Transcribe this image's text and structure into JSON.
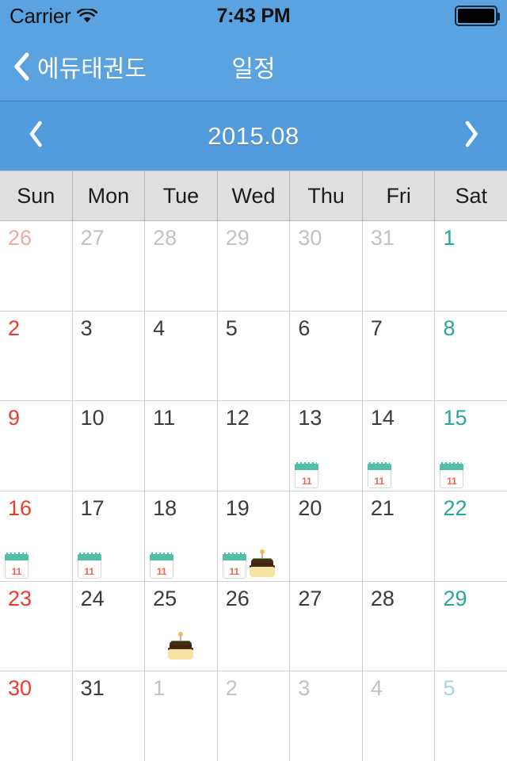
{
  "status_bar": {
    "carrier": "Carrier",
    "wifi_icon": "wifi-icon",
    "time": "7:43 PM",
    "battery_icon": "battery-full-icon"
  },
  "nav_bar": {
    "back_icon": "chevron-left-icon",
    "back_label": "에듀태권도",
    "title": "일정"
  },
  "month_bar": {
    "prev_icon": "chevron-left-icon",
    "next_icon": "chevron-right-icon",
    "month_label": "2015.08"
  },
  "weekdays": [
    "Sun",
    "Mon",
    "Tue",
    "Wed",
    "Thu",
    "Fri",
    "Sat"
  ],
  "colors": {
    "header_blue": "#5AA2E0",
    "month_blue": "#529CDE",
    "weekday_header_bg": "#E0E0E0",
    "grid_line": "#CFCFCF",
    "sunday_red": "#EE3B2E",
    "saturday_teal": "#29A59A",
    "weekday_text": "#3B3B3B",
    "outside_gray": "#C2C2C2",
    "outside_sun": "#F4A6A0",
    "outside_sat": "#A8D4EE"
  },
  "weeks": [
    [
      {
        "num": "26",
        "style": "d-out-sun",
        "icons": []
      },
      {
        "num": "27",
        "style": "d-out",
        "icons": []
      },
      {
        "num": "28",
        "style": "d-out",
        "icons": []
      },
      {
        "num": "29",
        "style": "d-out",
        "icons": []
      },
      {
        "num": "30",
        "style": "d-out",
        "icons": []
      },
      {
        "num": "31",
        "style": "d-out",
        "icons": []
      },
      {
        "num": "1",
        "style": "d-sat",
        "icons": []
      }
    ],
    [
      {
        "num": "2",
        "style": "d-sun",
        "icons": []
      },
      {
        "num": "3",
        "style": "d-weekday",
        "icons": []
      },
      {
        "num": "4",
        "style": "d-weekday",
        "icons": []
      },
      {
        "num": "5",
        "style": "d-weekday",
        "icons": []
      },
      {
        "num": "6",
        "style": "d-weekday",
        "icons": []
      },
      {
        "num": "7",
        "style": "d-weekday",
        "icons": []
      },
      {
        "num": "8",
        "style": "d-sat",
        "icons": []
      }
    ],
    [
      {
        "num": "9",
        "style": "d-sun",
        "icons": []
      },
      {
        "num": "10",
        "style": "d-weekday",
        "icons": []
      },
      {
        "num": "11",
        "style": "d-weekday",
        "icons": []
      },
      {
        "num": "12",
        "style": "d-weekday",
        "icons": []
      },
      {
        "num": "13",
        "style": "d-weekday",
        "icons": [
          "calendar-event-icon"
        ]
      },
      {
        "num": "14",
        "style": "d-weekday",
        "icons": [
          "calendar-event-icon"
        ]
      },
      {
        "num": "15",
        "style": "d-sat",
        "icons": [
          "calendar-event-icon"
        ]
      }
    ],
    [
      {
        "num": "16",
        "style": "d-sun",
        "icons": [
          "calendar-event-icon"
        ]
      },
      {
        "num": "17",
        "style": "d-weekday",
        "icons": [
          "calendar-event-icon"
        ]
      },
      {
        "num": "18",
        "style": "d-weekday",
        "icons": [
          "calendar-event-icon"
        ]
      },
      {
        "num": "19",
        "style": "d-weekday",
        "icons": [
          "calendar-event-icon",
          "birthday-cake-icon"
        ]
      },
      {
        "num": "20",
        "style": "d-weekday",
        "icons": []
      },
      {
        "num": "21",
        "style": "d-weekday",
        "icons": []
      },
      {
        "num": "22",
        "style": "d-sat",
        "icons": []
      }
    ],
    [
      {
        "num": "23",
        "style": "d-sun",
        "icons": []
      },
      {
        "num": "24",
        "style": "d-weekday",
        "icons": []
      },
      {
        "num": "25",
        "style": "d-weekday",
        "icons": [
          "birthday-cake-icon"
        ],
        "icons_centered": true
      },
      {
        "num": "26",
        "style": "d-weekday",
        "icons": []
      },
      {
        "num": "27",
        "style": "d-weekday",
        "icons": []
      },
      {
        "num": "28",
        "style": "d-weekday",
        "icons": []
      },
      {
        "num": "29",
        "style": "d-sat",
        "icons": []
      }
    ],
    [
      {
        "num": "30",
        "style": "d-sun",
        "icons": []
      },
      {
        "num": "31",
        "style": "d-weekday",
        "icons": []
      },
      {
        "num": "1",
        "style": "d-out",
        "icons": []
      },
      {
        "num": "2",
        "style": "d-out",
        "icons": []
      },
      {
        "num": "3",
        "style": "d-out",
        "icons": []
      },
      {
        "num": "4",
        "style": "d-out",
        "icons": []
      },
      {
        "num": "5",
        "style": "d-out-sat",
        "icons": []
      }
    ]
  ],
  "event_badge": {
    "calendar_number": "11"
  }
}
